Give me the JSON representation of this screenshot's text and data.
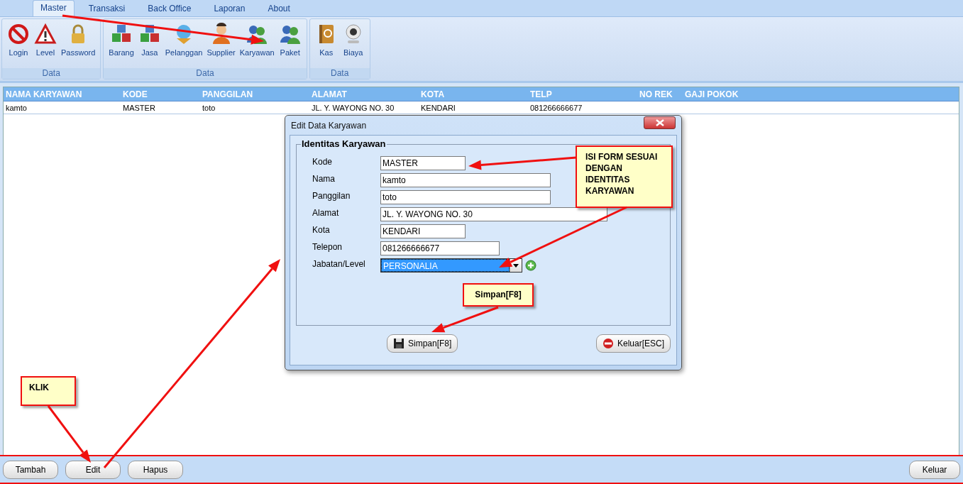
{
  "menu_tabs": [
    {
      "label": "Master",
      "selected": true
    },
    {
      "label": "Transaksi",
      "selected": false
    },
    {
      "label": "Back Office",
      "selected": false
    },
    {
      "label": "Laporan",
      "selected": false
    },
    {
      "label": "About",
      "selected": false
    }
  ],
  "ribbon_groups": [
    {
      "label": "Data",
      "buttons": [
        "Login",
        "Level",
        "Password"
      ]
    },
    {
      "label": "Data",
      "buttons": [
        "Barang",
        "Jasa",
        "Pelanggan",
        "Supplier",
        "Karyawan",
        "Paket"
      ]
    },
    {
      "label": "Data",
      "buttons": [
        "Kas",
        "Biaya"
      ]
    }
  ],
  "table": {
    "columns": [
      "NAMA KARYAWAN",
      "KODE",
      "PANGGILAN",
      "ALAMAT",
      "KOTA",
      "TELP",
      "NO REK",
      "GAJI POKOK"
    ],
    "rows": [
      [
        "kamto",
        "MASTER",
        "toto",
        "JL. Y. WAYONG NO. 30",
        "KENDARI",
        "081266666677"
      ]
    ]
  },
  "dialog": {
    "title": "Edit Data Karyawan",
    "group_title": "Identitas Karyawan",
    "fields": [
      {
        "label": "Kode",
        "value": "MASTER",
        "kind": "text"
      },
      {
        "label": "Nama",
        "value": "kamto",
        "kind": "text"
      },
      {
        "label": "Panggilan",
        "value": "toto",
        "kind": "text"
      },
      {
        "label": "Alamat",
        "value": "JL. Y. WAYONG NO. 30",
        "kind": "text"
      },
      {
        "label": "Kota",
        "value": "KENDARI",
        "kind": "text"
      },
      {
        "label": "Telepon",
        "value": "081266666677",
        "kind": "text"
      },
      {
        "label": "Jabatan/Level",
        "value": "PERSONALIA",
        "kind": "dropdown"
      }
    ],
    "buttons": [
      "Simpan[F8]",
      "Keluar[ESC]"
    ]
  },
  "bottom_buttons": [
    "Tambah",
    "Edit",
    "Hapus"
  ],
  "exit_button": "Keluar",
  "callouts": [
    "ISI FORM SESUAI DENGAN IDENTITAS KARYAWAN",
    "Simpan[F8]",
    "KLIK"
  ]
}
